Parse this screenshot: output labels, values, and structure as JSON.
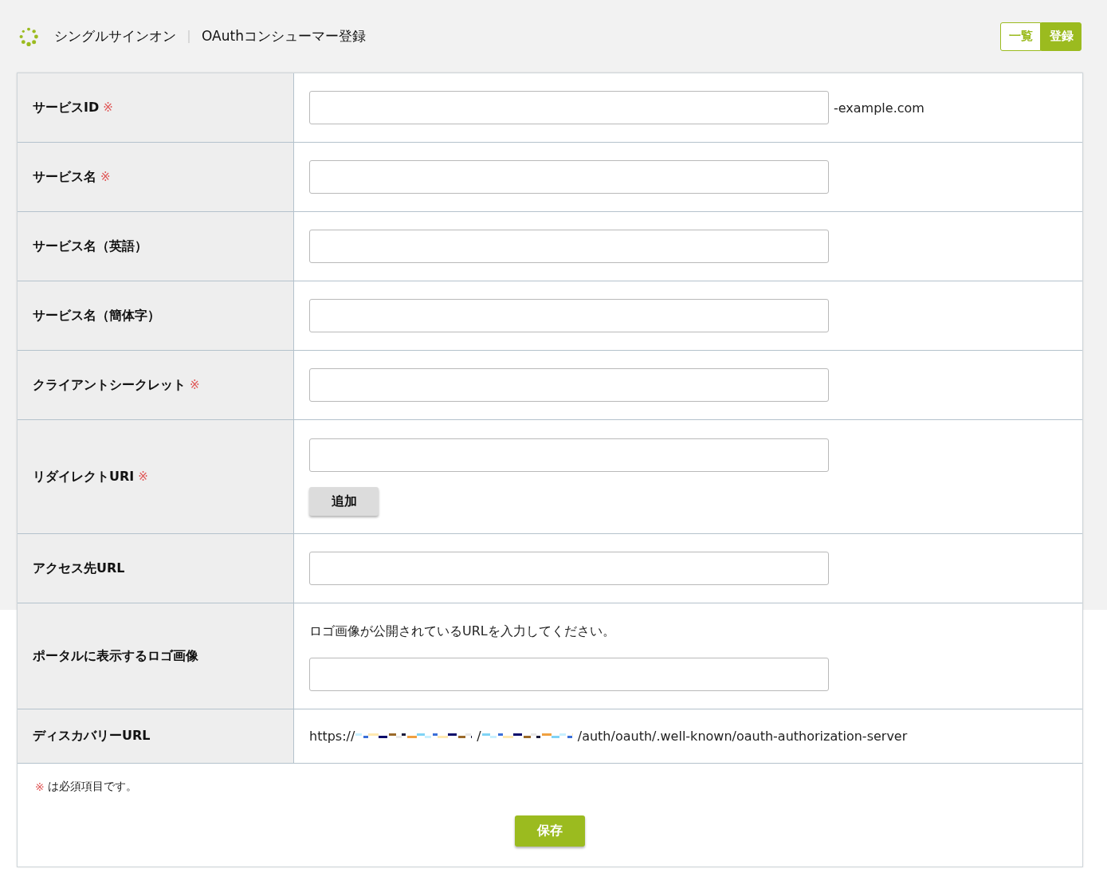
{
  "header": {
    "app_title": "シングルサインオン",
    "page_title": "OAuthコンシューマー登録"
  },
  "nav_buttons": [
    {
      "label": "一覧",
      "selected": false
    },
    {
      "label": "登録",
      "selected": true
    }
  ],
  "form": {
    "rows": [
      {
        "label": "サービスID",
        "mark": "※",
        "kind": "input",
        "suffix": "-example.com"
      },
      {
        "label": "サービス名",
        "mark": "※",
        "kind": "input"
      },
      {
        "label": "サービス名（英語）",
        "kind": "input"
      },
      {
        "label": "サービス名（簡体字）",
        "kind": "input"
      },
      {
        "label": "クライアントシークレット",
        "mark": "※",
        "kind": "input"
      },
      {
        "label": "リダイレクトURI",
        "mark": "※",
        "kind": "input_add",
        "add_button": "追加"
      },
      {
        "label": "アクセス先URL",
        "kind": "input"
      },
      {
        "label": "ポータルに表示するロゴ画像",
        "kind": "hint_input",
        "hint": "ロゴ画像が公開されているURLを入力してください。"
      },
      {
        "label": "ディスカバリーURL",
        "kind": "url",
        "parts": [
          {
            "kind": "text",
            "text": "https://"
          },
          {
            "kind": "redacted"
          },
          {
            "kind": "text",
            "text": "/"
          },
          {
            "kind": "redacted"
          },
          {
            "kind": "text",
            "text": "/auth/oauth/.well-known/oauth-authorization-server"
          }
        ]
      }
    ]
  },
  "note": {
    "mark": "※",
    "text": "は必須項目です。"
  },
  "save_button": "保存"
}
